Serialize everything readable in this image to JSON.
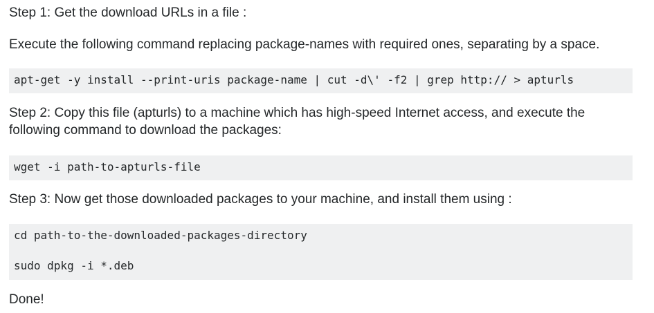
{
  "steps": {
    "step1_title": "Step 1: Get the download URLs in a file :",
    "step1_desc": "Execute the following command replacing package-names with required ones, separating by a space.",
    "step1_code": "apt-get -y install --print-uris package-name | cut -d\\' -f2 | grep http:// > apturls",
    "step2_line1": "Step 2: Copy this file (apturls) to a machine which has high-speed Internet access, and execute the",
    "step2_line2": "following command to download the packages:",
    "step2_code": "wget -i path-to-apturls-file",
    "step3_title": "Step 3: Now get those downloaded packages to your machine, and install them using :",
    "step3_code_line1": "cd path-to-the-downloaded-packages-directory",
    "step3_code_line2": "sudo dpkg -i *.deb",
    "done": "Done!"
  }
}
